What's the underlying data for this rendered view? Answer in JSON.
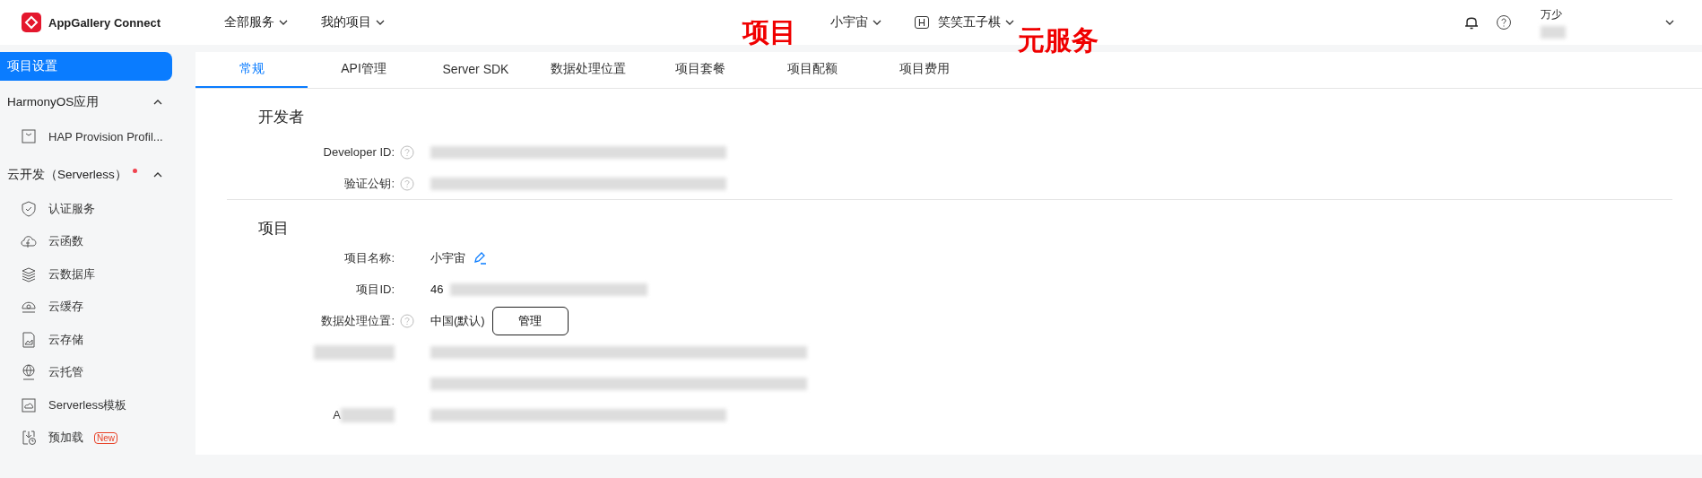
{
  "header": {
    "logo_text": "AppGallery Connect",
    "nav": [
      {
        "label": "全部服务"
      },
      {
        "label": "我的项目"
      }
    ],
    "project_switch": {
      "label": "小宇宙"
    },
    "app_switch": {
      "badge": "H",
      "label": "笑笑五子棋"
    },
    "user": {
      "name": "万少"
    },
    "annotations": [
      {
        "text": "项目"
      },
      {
        "text": "元服务"
      }
    ]
  },
  "sidebar": {
    "top_item": {
      "label": "项目设置",
      "selected": true
    },
    "groups": [
      {
        "label": "HarmonyOS应用",
        "expanded": true,
        "dot": false,
        "children": [
          {
            "label": "HAP Provision Profil...",
            "kind": "profile"
          }
        ]
      },
      {
        "label": "云开发（Serverless）",
        "expanded": true,
        "dot": true,
        "children": [
          {
            "label": "认证服务",
            "kind": "shield"
          },
          {
            "label": "云函数",
            "kind": "cloud-fn"
          },
          {
            "label": "云数据库",
            "kind": "stack"
          },
          {
            "label": "云缓存",
            "kind": "cache"
          },
          {
            "label": "云存储",
            "kind": "storage"
          },
          {
            "label": "云托管",
            "kind": "globe"
          },
          {
            "label": "Serverless模板",
            "kind": "template"
          },
          {
            "label": "预加载",
            "kind": "preload",
            "badge": "New"
          }
        ]
      }
    ]
  },
  "tabs": [
    {
      "label": "常规",
      "selected": true
    },
    {
      "label": "API管理",
      "selected": false
    },
    {
      "label": "Server SDK",
      "selected": false
    },
    {
      "label": "数据处理位置",
      "selected": false
    },
    {
      "label": "项目套餐",
      "selected": false
    },
    {
      "label": "项目配额",
      "selected": false
    },
    {
      "label": "项目费用",
      "selected": false
    }
  ],
  "sections": [
    {
      "title": "开发者",
      "fields": [
        {
          "label": "Developer ID:",
          "help": true,
          "value_redacted": true
        },
        {
          "label": "验证公钥:",
          "help": true,
          "value_redacted": true
        }
      ]
    },
    {
      "title": "项目",
      "fields": [
        {
          "label": "项目名称:",
          "help": false,
          "value": "小宇宙",
          "editable": true
        },
        {
          "label": "项目ID:",
          "help": false,
          "value": "46",
          "value_redacted": true
        },
        {
          "label": "数据处理位置:",
          "help": true,
          "value": "中国(默认)",
          "button": "管理"
        },
        {
          "label_redacted": true,
          "help": false,
          "value_redacted": true
        },
        {
          "help": false,
          "value_redacted": true
        },
        {
          "label": "A",
          "label_redacted": true,
          "help": false,
          "value_redacted": true
        }
      ]
    }
  ]
}
